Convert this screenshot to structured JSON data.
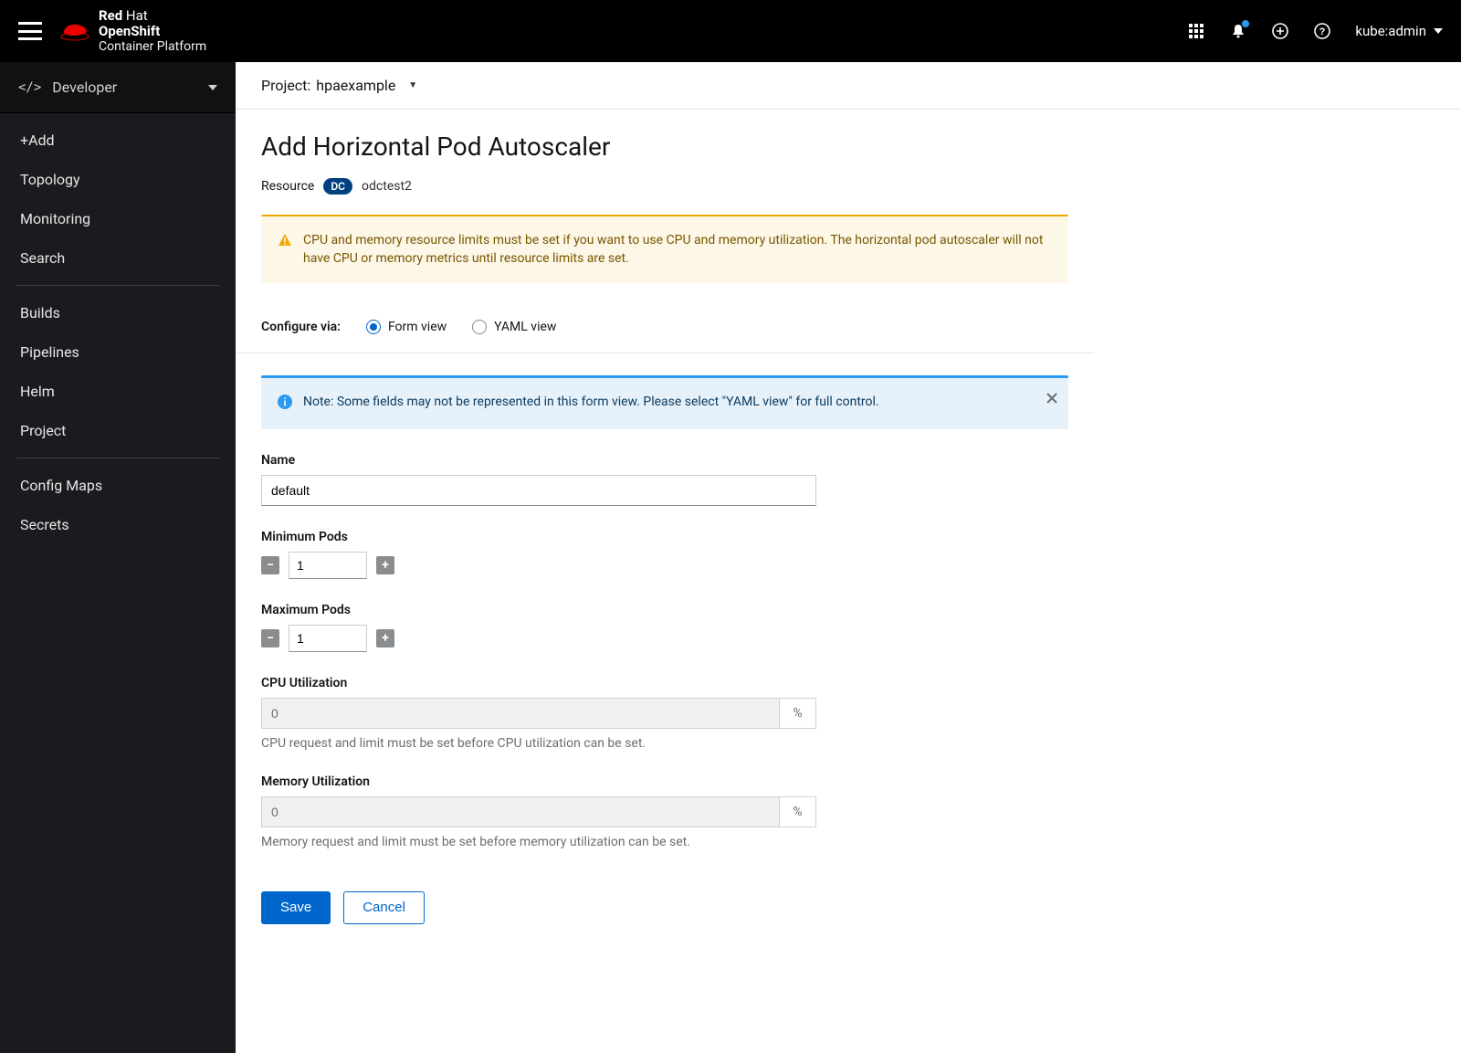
{
  "brand": {
    "line1_a": "Red",
    "line1_b": "Hat",
    "line2": "OpenShift",
    "line3": "Container Platform"
  },
  "user": "kube:admin",
  "perspective": "Developer",
  "sidebar": {
    "items": [
      "+Add",
      "Topology",
      "Monitoring",
      "Search",
      "Builds",
      "Pipelines",
      "Helm",
      "Project",
      "Config Maps",
      "Secrets"
    ]
  },
  "project_label": "Project:",
  "project_name": "hpaexample",
  "page_title": "Add Horizontal Pod Autoscaler",
  "resource_label": "Resource",
  "resource_badge": "DC",
  "resource_name": "odctest2",
  "warning_text": "CPU and memory resource limits must be set if you want to use CPU and memory utilization. The horizontal pod autoscaler will not have CPU or memory metrics until resource limits are set.",
  "configure_label": "Configure via:",
  "view_form": "Form view",
  "view_yaml": "YAML view",
  "info_text": "Note: Some fields may not be represented in this form view. Please select \"YAML view\" for full control.",
  "fields": {
    "name_label": "Name",
    "name_value": "default",
    "min_label": "Minimum Pods",
    "min_value": "1",
    "max_label": "Maximum Pods",
    "max_value": "1",
    "cpu_label": "CPU Utilization",
    "cpu_value": "0",
    "cpu_help": "CPU request and limit must be set before CPU utilization can be set.",
    "mem_label": "Memory Utilization",
    "mem_value": "0",
    "mem_help": "Memory request and limit must be set before memory utilization can be set.",
    "unit": "%"
  },
  "buttons": {
    "save": "Save",
    "cancel": "Cancel"
  }
}
